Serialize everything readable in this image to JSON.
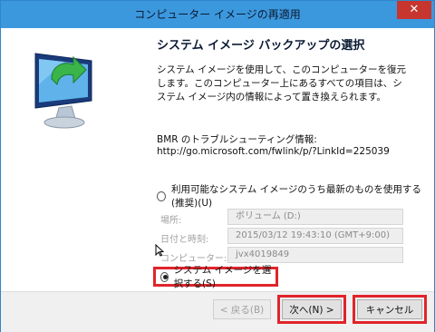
{
  "window": {
    "title": "コンピューター イメージの再適用",
    "close": "✕"
  },
  "page": {
    "heading": "システム イメージ バックアップの選択",
    "description": "システム イメージを使用して、このコンピューターを復元します。このコンピューター上にあるすべての項目は、システム イメージ内の情報によって置き換えられます。",
    "bmr_label": "BMR のトラブルシューティング情報:",
    "bmr_url": "http://go.microsoft.com/fwlink/p/?LinkId=225039"
  },
  "options": {
    "latest_label": "利用可能なシステム イメージのうち最新のものを使用する (推奨)(U)",
    "select_label": "システム イメージを選択する(S)"
  },
  "details": {
    "location_label": "場所:",
    "location_value": "ボリューム (D:)",
    "datetime_label": "日付と時刻:",
    "datetime_value": "2015/03/12 19:43:10 (GMT+9:00)",
    "computer_label": "コンピューター:",
    "computer_value": "jvx4019849"
  },
  "buttons": {
    "back": "< 戻る(B)",
    "next": "次へ(N) >",
    "cancel": "キャンセル"
  },
  "colors": {
    "titlebar": "#3c98dd",
    "highlight": "#e0242b"
  }
}
